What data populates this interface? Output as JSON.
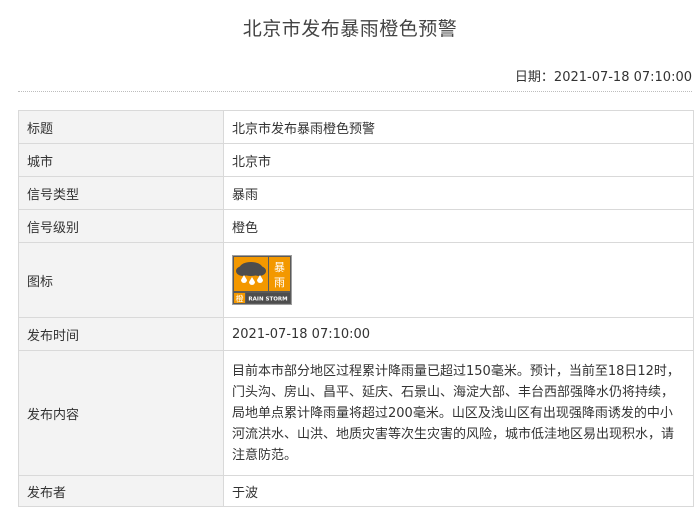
{
  "page": {
    "title": "北京市发布暴雨橙色预警",
    "date_label": "日期：",
    "date_value": "2021-07-18 07:10:00"
  },
  "rows": {
    "title": {
      "label": "标题",
      "value": "北京市发布暴雨橙色预警"
    },
    "city": {
      "label": "城市",
      "value": "北京市"
    },
    "signal_type": {
      "label": "信号类型",
      "value": "暴雨"
    },
    "signal_level": {
      "label": "信号级别",
      "value": "橙色"
    },
    "icon": {
      "label": "图标",
      "icon_name": "rainstorm-orange-warning-icon",
      "icon_chars": {
        "storm": "暴",
        "rain": "雨",
        "level": "橙",
        "english": "RAIN STORM"
      },
      "colors": {
        "orange": "#f39800",
        "dark": "#4d4d4d",
        "gray": "#9e9e9e"
      }
    },
    "publish_time": {
      "label": "发布时间",
      "value": "2021-07-18 07:10:00"
    },
    "content": {
      "label": "发布内容",
      "value": "目前本市部分地区过程累计降雨量已超过150毫米。预计，当前至18日12时，门头沟、房山、昌平、延庆、石景山、海淀大部、丰台西部强降水仍将持续，局地单点累计降雨量将超过200毫米。山区及浅山区有出现强降雨诱发的中小河流洪水、山洪、地质灾害等次生灾害的风险，城市低洼地区易出现积水，请注意防范。"
    },
    "publisher": {
      "label": "发布者",
      "value": "于波"
    }
  }
}
